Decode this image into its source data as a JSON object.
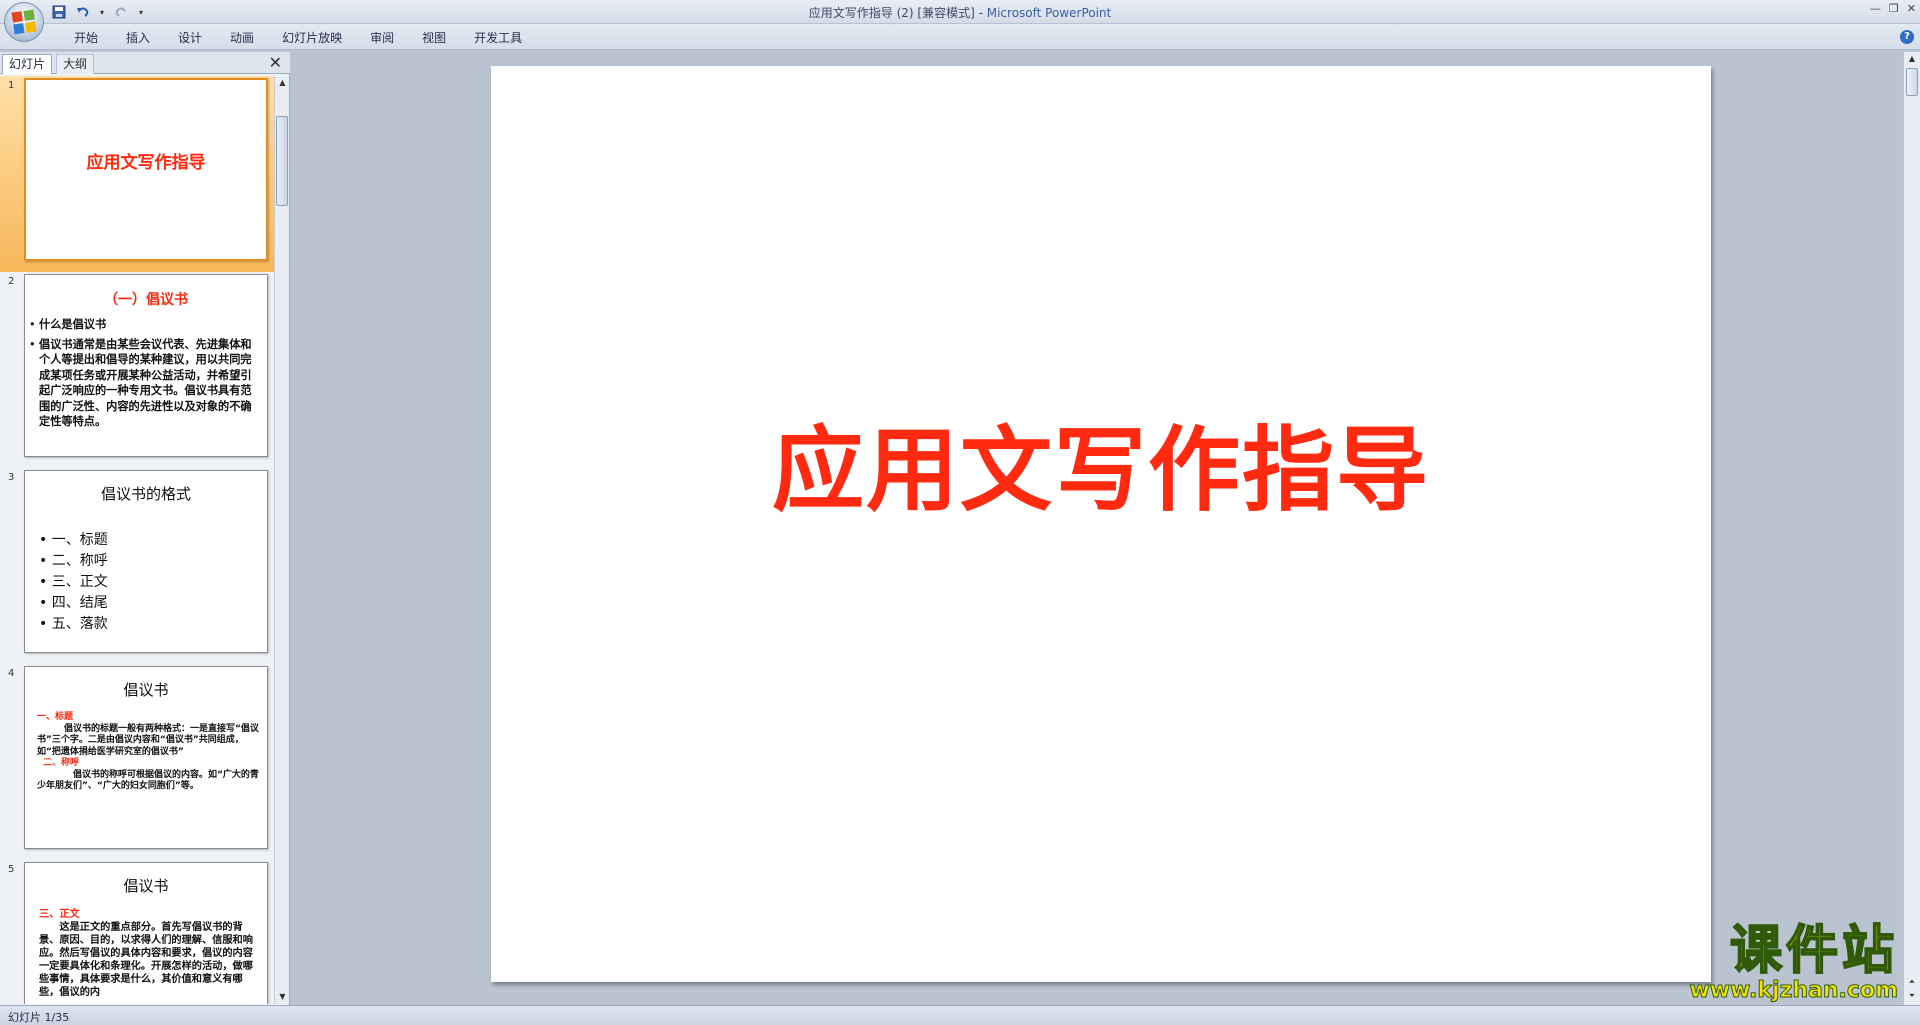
{
  "window": {
    "title": "应用文写作指导 (2) [兼容模式]",
    "separator": " - ",
    "app_name": "Microsoft PowerPoint"
  },
  "ribbon": {
    "tabs": [
      "开始",
      "插入",
      "设计",
      "动画",
      "幻灯片放映",
      "审阅",
      "视图",
      "开发工具"
    ]
  },
  "left_panel": {
    "tab_slides": "幻灯片",
    "tab_outline": "大纲",
    "close_glyph": "✕"
  },
  "thumbnails": [
    {
      "number": "1",
      "title": "应用文写作指导"
    },
    {
      "number": "2",
      "heading": "（一）倡议书",
      "bullets": [
        "什么是倡议书",
        "倡议书通常是由某些会议代表、先进集体和个人等提出和倡导的某种建议，用以共同完成某项任务或开展某种公益活动，并希望引起广泛响应的一种专用文书。倡议书具有范围的广泛性、内容的先进性以及对象的不确定性等特点。"
      ]
    },
    {
      "number": "3",
      "heading": "倡议书的格式",
      "items": [
        "一、标题",
        "二、称呼",
        "三、正文",
        "四、结尾",
        "五、落款"
      ]
    },
    {
      "number": "4",
      "heading": "倡议书",
      "sub1": "一、标题",
      "text1": "倡议书的标题一般有两种格式：一是直接写“倡议书”三个字。二是由倡议内容和“倡议书”共同组成，如“把遗体捐给医学研究室的倡议书”",
      "sub2": "二、称呼",
      "text2": "倡议书的称呼可根据倡议的内容。如“广大的青少年朋友们”、“广大的妇女同胞们”等。"
    },
    {
      "number": "5",
      "heading": "倡议书",
      "sub1": "三、正文",
      "text1": "这是正文的重点部分。首先写倡议书的背景、原因、目的，以求得人们的理解、信服和响应。然后写倡议的具体内容和要求，倡议的内容一定要具体化和条理化。开展怎样的活动，做哪些事情，具体要求是什么，其价值和意义有哪些，倡议的内"
    }
  ],
  "slide": {
    "title": "应用文写作指导"
  },
  "status": {
    "slide_indicator": "幻灯片 1/35"
  },
  "watermark": {
    "cn": "课件站",
    "url": "www.kjzhan.com"
  },
  "colors": {
    "title_red": "#ff2a10",
    "selection_orange": "#f7b75a",
    "watermark_yellow": "#f5e400"
  }
}
